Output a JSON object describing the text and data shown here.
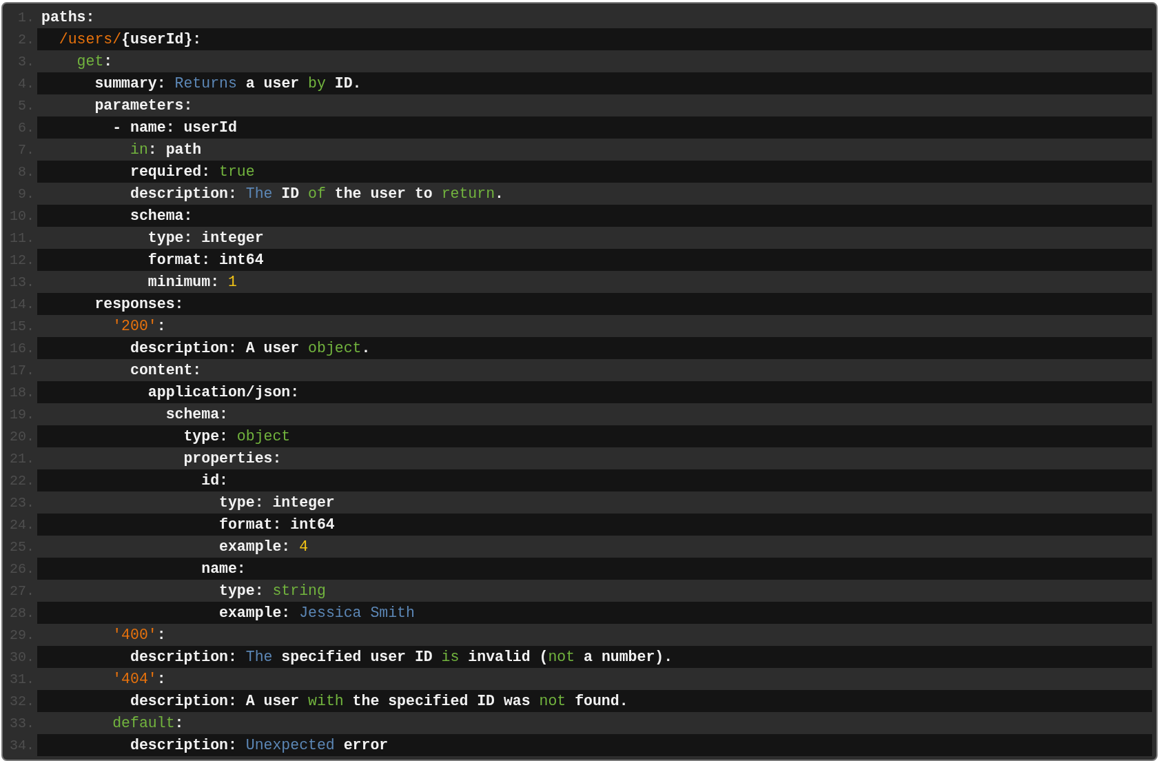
{
  "lines": [
    {
      "number": "1.",
      "tokens": [
        {
          "kind": "plain",
          "text": "paths:"
        }
      ]
    },
    {
      "number": "2.",
      "tokens": [
        {
          "kind": "path",
          "text": "  /users/"
        },
        {
          "kind": "plain",
          "text": "{userId}:"
        }
      ]
    },
    {
      "number": "3.",
      "tokens": [
        {
          "kind": "keyword",
          "text": "    get"
        },
        {
          "kind": "plain",
          "text": ":"
        }
      ]
    },
    {
      "number": "4.",
      "tokens": [
        {
          "kind": "plain",
          "text": "      summary: "
        },
        {
          "kind": "word",
          "text": "Returns"
        },
        {
          "kind": "plain",
          "text": " a user "
        },
        {
          "kind": "keyword",
          "text": "by"
        },
        {
          "kind": "plain",
          "text": " ID."
        }
      ]
    },
    {
      "number": "5.",
      "tokens": [
        {
          "kind": "plain",
          "text": "      parameters:"
        }
      ]
    },
    {
      "number": "6.",
      "tokens": [
        {
          "kind": "plain",
          "text": "        - name: userId"
        }
      ]
    },
    {
      "number": "7.",
      "tokens": [
        {
          "kind": "keyword",
          "text": "          in"
        },
        {
          "kind": "plain",
          "text": ": path"
        }
      ]
    },
    {
      "number": "8.",
      "tokens": [
        {
          "kind": "plain",
          "text": "          required: "
        },
        {
          "kind": "keyword",
          "text": "true"
        }
      ]
    },
    {
      "number": "9.",
      "tokens": [
        {
          "kind": "plain",
          "text": "          description: "
        },
        {
          "kind": "word",
          "text": "The"
        },
        {
          "kind": "plain",
          "text": " ID "
        },
        {
          "kind": "keyword",
          "text": "of"
        },
        {
          "kind": "plain",
          "text": " the user to "
        },
        {
          "kind": "keyword",
          "text": "return"
        },
        {
          "kind": "plain",
          "text": "."
        }
      ]
    },
    {
      "number": "10.",
      "tokens": [
        {
          "kind": "plain",
          "text": "          schema:"
        }
      ]
    },
    {
      "number": "11.",
      "tokens": [
        {
          "kind": "plain",
          "text": "            type: integer"
        }
      ]
    },
    {
      "number": "12.",
      "tokens": [
        {
          "kind": "plain",
          "text": "            format: int64"
        }
      ]
    },
    {
      "number": "13.",
      "tokens": [
        {
          "kind": "plain",
          "text": "            minimum: "
        },
        {
          "kind": "number",
          "text": "1"
        }
      ]
    },
    {
      "number": "14.",
      "tokens": [
        {
          "kind": "plain",
          "text": "      responses:"
        }
      ]
    },
    {
      "number": "15.",
      "tokens": [
        {
          "kind": "path",
          "text": "        '200'"
        },
        {
          "kind": "plain",
          "text": ":"
        }
      ]
    },
    {
      "number": "16.",
      "tokens": [
        {
          "kind": "plain",
          "text": "          description: A user "
        },
        {
          "kind": "keyword",
          "text": "object"
        },
        {
          "kind": "plain",
          "text": "."
        }
      ]
    },
    {
      "number": "17.",
      "tokens": [
        {
          "kind": "plain",
          "text": "          content:"
        }
      ]
    },
    {
      "number": "18.",
      "tokens": [
        {
          "kind": "plain",
          "text": "            application/json:"
        }
      ]
    },
    {
      "number": "19.",
      "tokens": [
        {
          "kind": "plain",
          "text": "              schema:"
        }
      ]
    },
    {
      "number": "20.",
      "tokens": [
        {
          "kind": "plain",
          "text": "                type: "
        },
        {
          "kind": "keyword",
          "text": "object"
        }
      ]
    },
    {
      "number": "21.",
      "tokens": [
        {
          "kind": "plain",
          "text": "                properties:"
        }
      ]
    },
    {
      "number": "22.",
      "tokens": [
        {
          "kind": "plain",
          "text": "                  id:"
        }
      ]
    },
    {
      "number": "23.",
      "tokens": [
        {
          "kind": "plain",
          "text": "                    type: integer"
        }
      ]
    },
    {
      "number": "24.",
      "tokens": [
        {
          "kind": "plain",
          "text": "                    format: int64"
        }
      ]
    },
    {
      "number": "25.",
      "tokens": [
        {
          "kind": "plain",
          "text": "                    example: "
        },
        {
          "kind": "number",
          "text": "4"
        }
      ]
    },
    {
      "number": "26.",
      "tokens": [
        {
          "kind": "plain",
          "text": "                  name:"
        }
      ]
    },
    {
      "number": "27.",
      "tokens": [
        {
          "kind": "plain",
          "text": "                    type: "
        },
        {
          "kind": "keyword",
          "text": "string"
        }
      ]
    },
    {
      "number": "28.",
      "tokens": [
        {
          "kind": "plain",
          "text": "                    example: "
        },
        {
          "kind": "word",
          "text": "Jessica Smith"
        }
      ]
    },
    {
      "number": "29.",
      "tokens": [
        {
          "kind": "path",
          "text": "        '400'"
        },
        {
          "kind": "plain",
          "text": ":"
        }
      ]
    },
    {
      "number": "30.",
      "tokens": [
        {
          "kind": "plain",
          "text": "          description: "
        },
        {
          "kind": "word",
          "text": "The"
        },
        {
          "kind": "plain",
          "text": " specified user ID "
        },
        {
          "kind": "keyword",
          "text": "is"
        },
        {
          "kind": "plain",
          "text": " invalid ("
        },
        {
          "kind": "keyword",
          "text": "not"
        },
        {
          "kind": "plain",
          "text": " a number)."
        }
      ]
    },
    {
      "number": "31.",
      "tokens": [
        {
          "kind": "path",
          "text": "        '404'"
        },
        {
          "kind": "plain",
          "text": ":"
        }
      ]
    },
    {
      "number": "32.",
      "tokens": [
        {
          "kind": "plain",
          "text": "          description: A user "
        },
        {
          "kind": "keyword",
          "text": "with"
        },
        {
          "kind": "plain",
          "text": " the specified ID was "
        },
        {
          "kind": "keyword",
          "text": "not"
        },
        {
          "kind": "plain",
          "text": " found."
        }
      ]
    },
    {
      "number": "33.",
      "tokens": [
        {
          "kind": "keyword",
          "text": "        default"
        },
        {
          "kind": "plain",
          "text": ":"
        }
      ]
    },
    {
      "number": "34.",
      "tokens": [
        {
          "kind": "plain",
          "text": "          description: "
        },
        {
          "kind": "word",
          "text": "Unexpected"
        },
        {
          "kind": "plain",
          "text": " error"
        }
      ]
    }
  ]
}
